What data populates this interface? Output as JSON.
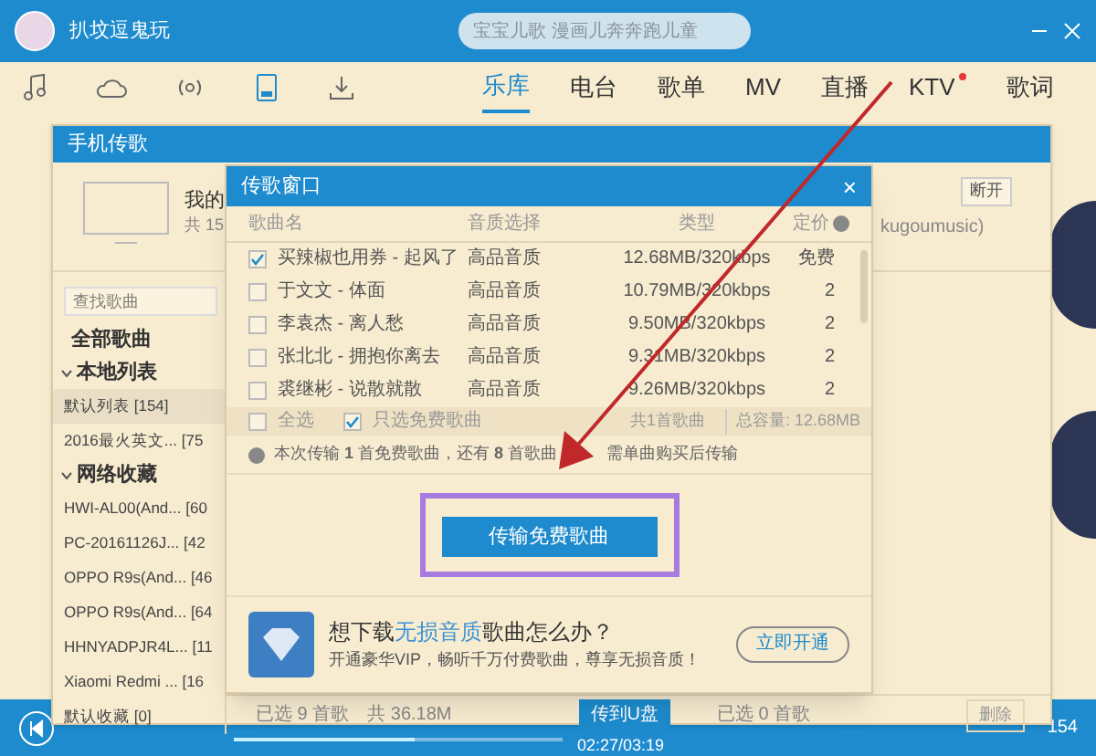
{
  "top_bar": {
    "username": "扒坟逗鬼玩",
    "search": {
      "placeholder": "宝宝儿歌 漫画儿奔奔跑儿童"
    }
  },
  "nav_tabs": [
    {
      "label": "乐库",
      "selected": true,
      "dot": false
    },
    {
      "label": "电台",
      "selected": false,
      "dot": false
    },
    {
      "label": "歌单",
      "selected": false,
      "dot": false
    },
    {
      "label": "MV",
      "selected": false,
      "dot": false
    },
    {
      "label": "直播",
      "selected": false,
      "dot": false
    },
    {
      "label": "KTV",
      "selected": false,
      "dot": true
    },
    {
      "label": "歌词",
      "selected": false,
      "dot": false
    }
  ],
  "phone_dialog": {
    "title": "手机传歌",
    "device_name": "我的",
    "device_count": "共 15",
    "device_account": "kugoumusic)",
    "disconnect_button": "断开",
    "search": {
      "placeholder": "查找歌曲"
    },
    "all_songs": "全部歌曲",
    "groups": [
      {
        "label": "本地列表",
        "expanded": true,
        "children": [
          {
            "label": "默认列表",
            "count": "[154]",
            "selected": true
          },
          {
            "label": "2016最火英文...",
            "count": "[75",
            "selected": false
          }
        ]
      },
      {
        "label": "网络收藏",
        "expanded": true,
        "children": [
          {
            "label": "HWI-AL00(And...",
            "count": "[60",
            "selected": false
          },
          {
            "label": "PC-20161126J...",
            "count": "[42",
            "selected": false
          },
          {
            "label": "OPPO R9s(And...",
            "count": "[46",
            "selected": false
          },
          {
            "label": "OPPO R9s(And...",
            "count": "[64",
            "selected": false
          },
          {
            "label": "HHNYADPJR4L...",
            "count": "[11",
            "selected": false
          },
          {
            "label": "Xiaomi Redmi ...",
            "count": "[16",
            "selected": false
          },
          {
            "label": "默认收藏",
            "count": "[0]",
            "selected": false
          }
        ]
      }
    ],
    "footer": {
      "selected_label": "已选",
      "selected_count": "9",
      "selected_unit": "首歌",
      "total": "共 36.18M",
      "upload_button": "传到U盘",
      "right_selected_label": "已选",
      "right_selected_count": "0",
      "right_selected_unit": "首歌",
      "delete_button": "删除",
      "delete_disabled": true
    }
  },
  "transfer_dialog": {
    "title": "传歌窗口",
    "close": "×",
    "columns": [
      "歌曲名",
      "音质选择",
      "类型",
      "定价"
    ],
    "rows": [
      {
        "checked": true,
        "song": "买辣椒也用券 - 起风了",
        "quality": "高品音质",
        "size": "12.68MB/320kbps",
        "price": "免费"
      },
      {
        "checked": false,
        "song": "于文文 - 体面",
        "quality": "高品音质",
        "size": "10.79MB/320kbps",
        "price": "2"
      },
      {
        "checked": false,
        "song": "李袁杰 - 离人愁",
        "quality": "高品音质",
        "size": "9.50MB/320kbps",
        "price": "2"
      },
      {
        "checked": false,
        "song": "张北北 - 拥抱你离去",
        "quality": "高品音质",
        "size": "9.31MB/320kbps",
        "price": "2"
      },
      {
        "checked": false,
        "song": "裘继彬 - 说散就散",
        "quality": "高品音质",
        "size": "9.26MB/320kbps",
        "price": "2"
      }
    ],
    "select_all": {
      "label": "全选",
      "checked": false
    },
    "free_only": {
      "label": "只选免费歌曲",
      "checked": true
    },
    "song_count": "共1首歌曲",
    "total_size": "总容量: 12.68MB",
    "notice": [
      "本次传输 **1** 首免费歌曲，还有 **8** 首歌曲",
      "需单曲购买后传输"
    ],
    "transfer_button": "传输免费歌曲",
    "promo": {
      "title_before": "想下载",
      "title_highlight": "无损音质",
      "title_after": "歌曲怎么办？",
      "subtitle": "开通豪华VIP，畅听千万付费歌曲，尊享无损音质！",
      "button": "立即开通"
    }
  },
  "player": {
    "time": "02:27/03:19",
    "level": 0.55,
    "count": "154"
  }
}
